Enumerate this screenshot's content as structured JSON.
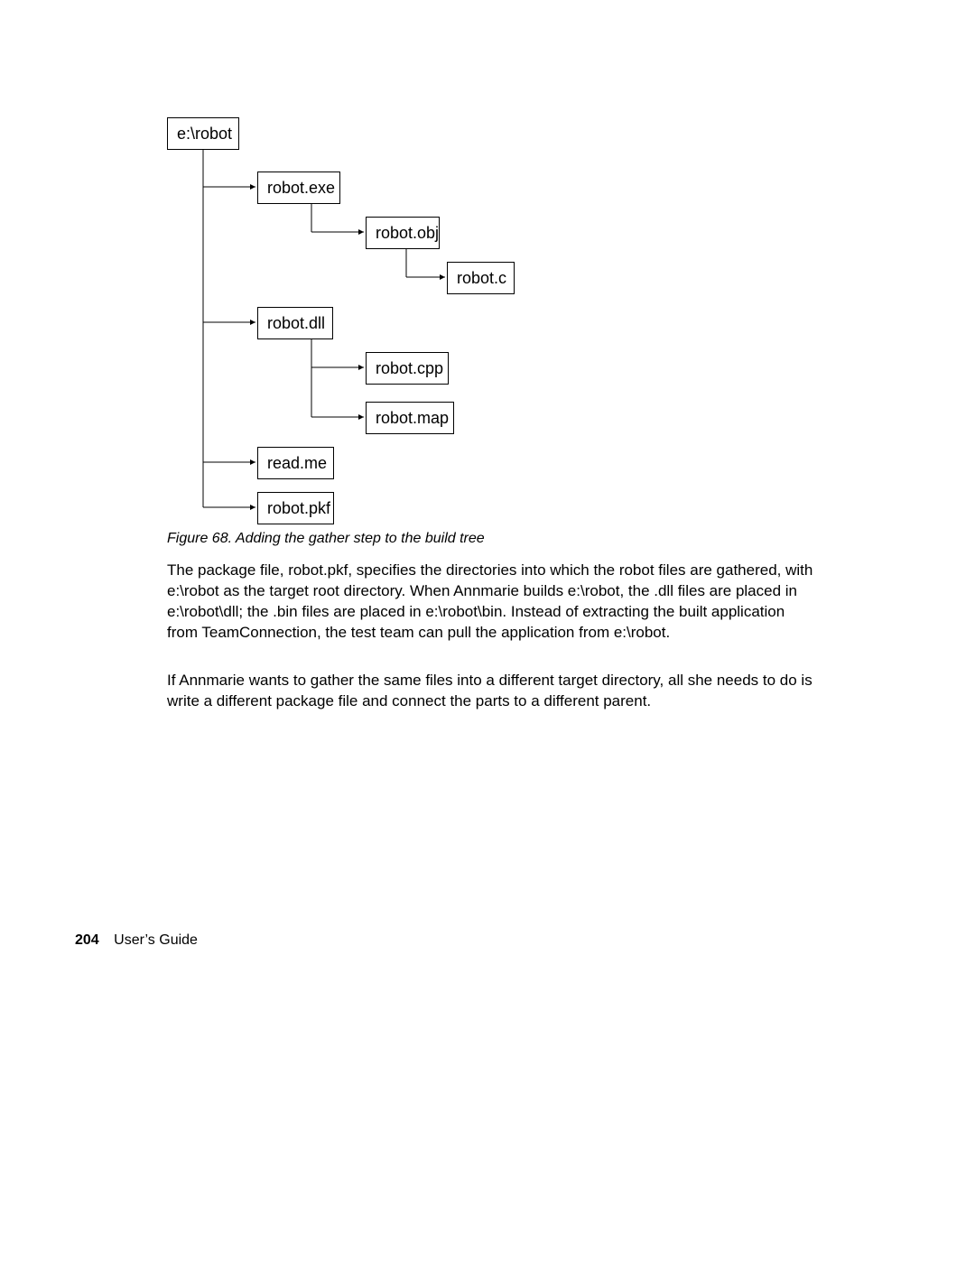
{
  "tree": {
    "root": "e:\\robot",
    "exe": "robot.exe",
    "obj": "robot.obj",
    "c": "robot.c",
    "dll": "robot.dll",
    "cpp": "robot.cpp",
    "map": "robot.map",
    "readme": "read.me",
    "pkf": "robot.pkf"
  },
  "caption": {
    "fig": "Figure 68.",
    "text": "Adding the gather step to the build tree"
  },
  "paragraphs": {
    "p1": "The package file, robot.pkf, specifies the directories into which the robot files are gathered, with e:\\robot as the target root directory. When Annmarie builds e:\\robot, the .dll files are placed in e:\\robot\\dll; the .bin files are placed in e:\\robot\\bin. Instead of extracting the built application from TeamConnection, the test team can pull the application from e:\\robot.",
    "p2": "If Annmarie wants to gather the same files into a different target directory, all she needs to do is write a different package file and connect the parts to a different parent."
  },
  "footer": {
    "page": "204",
    "title": "User’s Guide"
  }
}
